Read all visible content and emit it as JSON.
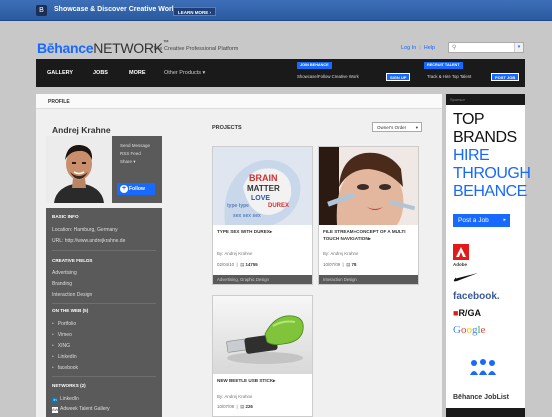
{
  "top_banner": {
    "text": "Showcase & Discover Creative Work",
    "learn_more": "LEARN MORE ›"
  },
  "header": {
    "brand_bold": "Bēhance",
    "brand_rest": "NETWORK",
    "brand_tm": "™",
    "tagline": "The Creative Professional Platform",
    "login": "Log In",
    "help": "Help",
    "search_icon": "search-icon"
  },
  "nav": {
    "items": [
      "GALLERY",
      "JOBS",
      "MORE"
    ],
    "other": "Other Products ▾",
    "promo_join": {
      "tag": "JOIN BEHANCE",
      "text": "Showcase/Follow Creative Work",
      "button": "SIGN UP"
    },
    "promo_recruit": {
      "tag": "RECRUIT TALENT",
      "text": "Track & Hire Top Talent",
      "button": "POST JOB"
    }
  },
  "profile": {
    "label": "PROFILE",
    "name": "Andrej Krahne",
    "links": [
      "Send Message",
      "RSS Feed",
      "Share ▾"
    ],
    "follow": "Follow",
    "basic_info_title": "BASIC INFO",
    "location": "Location: Hamburg, Germany",
    "url": "URL: http://www.andrejkrahne.de",
    "creative_fields_title": "CREATIVE FIELDS",
    "creative_fields": [
      "Advertising",
      "Branding",
      "Interaction Design"
    ],
    "web_title": "ON THE WEB (5)",
    "web": [
      "Portfolio",
      "Vimeo",
      "XING",
      "LinkedIn",
      "facebook"
    ],
    "networks_title": "NETWORKS (2)",
    "networks": [
      {
        "icon": "in",
        "label": "LinkedIn"
      },
      {
        "icon": "AW",
        "label": "Adweek Talent Gallery"
      }
    ]
  },
  "projects": {
    "title": "PROJECTS",
    "sort": "Owner's Order",
    "items": [
      {
        "title": "TYPE SEX WITH DUREX▸",
        "by": "By: Andrej Krahne",
        "date": "02/04/10",
        "views": "14755",
        "tags": "Advertising, Graphic Design"
      },
      {
        "title": "FILE STREAM»CONCEPT OF A MULTI TOUCH NAVIGATION▸",
        "by": "By: Andrej Krahne",
        "date": "10/07/09",
        "views": "78",
        "tags": "Interaction Design"
      },
      {
        "title": "NEW BEETLE USB STICK▸",
        "by": "By: Andrej Krahne",
        "date": "10/07/09",
        "views": "226",
        "tags": ""
      }
    ]
  },
  "ad": {
    "sponsor": "Sponsor",
    "headline": [
      "TOP",
      "BRANDS",
      "HIRE",
      "THROUGH",
      "BEHANCE"
    ],
    "post_job": "Post a Job",
    "brands": [
      "Adobe",
      "facebook.",
      "R/GA",
      "Google"
    ],
    "joblist": "Bēhance JobList",
    "colors": {
      "accent": "#1769ff",
      "dark": "#1a1a1a"
    }
  }
}
